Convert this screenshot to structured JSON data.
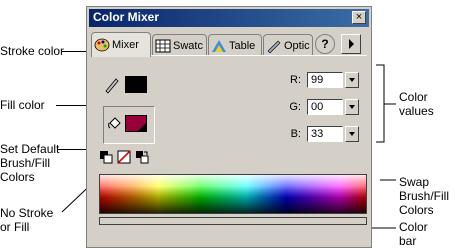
{
  "callouts": {
    "stroke_color": "Stroke color",
    "fill_color": "Fill color",
    "set_default": "Set Default\nBrush/Fill\nColors",
    "no_stroke": "No Stroke\nor Fill",
    "color_values": "Color\nvalues",
    "swap": "Swap\nBrush/Fill\nColors",
    "color_bar": "Color\nbar"
  },
  "panel": {
    "title": "Color Mixer",
    "close": "×",
    "tabs": [
      {
        "label": "Mixer",
        "icon": "palette-icon"
      },
      {
        "label": "Swatc",
        "icon": "grid-swatches-icon"
      },
      {
        "label": "Table",
        "icon": "table-icon"
      },
      {
        "label": "Optic",
        "icon": "options-icon"
      }
    ],
    "help": "?",
    "rgb": [
      {
        "label": "R:",
        "value": "99"
      },
      {
        "label": "G:",
        "value": "00"
      },
      {
        "label": "B:",
        "value": "33"
      }
    ],
    "colors": {
      "stroke": "#000000",
      "fill": "#99003a"
    }
  }
}
